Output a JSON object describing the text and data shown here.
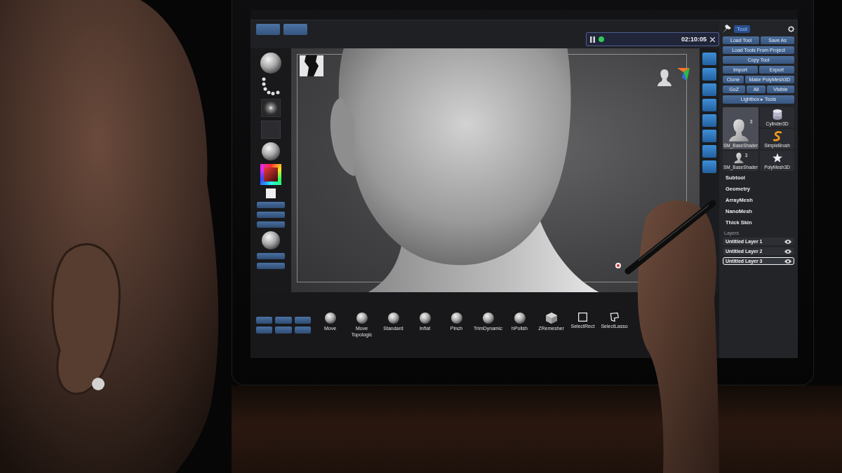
{
  "top_bar": {
    "timer": "02:10:05"
  },
  "tool_palette": {
    "title": "Tool",
    "button_rows": [
      [
        "Load Tool",
        "Save As"
      ],
      [
        "Load Tools From Project"
      ],
      [
        "Copy Tool"
      ],
      [
        "Import",
        "Export"
      ],
      [
        "Clone",
        "Make PolyMesh3D"
      ],
      [
        "GoZ",
        "All",
        "Visible"
      ],
      [
        "Lightbox ▸ Tools"
      ]
    ],
    "thumbnails": [
      {
        "label": "SM_BaseShader",
        "kind": "bust",
        "count": "3",
        "large": true,
        "selected": true
      },
      {
        "label": "Cylinder3D",
        "kind": "cylinder",
        "large": false,
        "selected": false
      },
      {
        "label": "SimpleBrush",
        "kind": "brush",
        "large": false,
        "selected": false
      },
      {
        "label": "SM_BaseShader",
        "kind": "bust",
        "count": "3",
        "large": false,
        "selected": false
      },
      {
        "label": "PolyMesh3D",
        "kind": "star",
        "large": false,
        "selected": false
      }
    ],
    "sections": [
      "Subtool",
      "Geometry",
      "ArrayMesh",
      "NanoMesh",
      "Thick Skin"
    ],
    "layers": {
      "title": "Layers",
      "items": [
        {
          "name": "Untitled Layer 1",
          "selected": false
        },
        {
          "name": "Untitled Layer 2",
          "selected": false
        },
        {
          "name": "Untitled Layer 3",
          "selected": true
        }
      ]
    }
  },
  "brush_shelf": {
    "items": [
      {
        "label": "Move",
        "kind": "sphere"
      },
      {
        "label": "Move Topologic",
        "kind": "sphere"
      },
      {
        "label": "Standard",
        "kind": "sphere"
      },
      {
        "label": "Inflat",
        "kind": "sphere"
      },
      {
        "label": "Pinch",
        "kind": "sphere"
      },
      {
        "label": "TrimDynamic",
        "kind": "sphere"
      },
      {
        "label": "hPolish",
        "kind": "sphere"
      },
      {
        "label": "ZRemesher",
        "kind": "cube"
      },
      {
        "label": "SelectRect",
        "kind": "rect"
      },
      {
        "label": "SelectLasso",
        "kind": "lasso"
      }
    ]
  }
}
